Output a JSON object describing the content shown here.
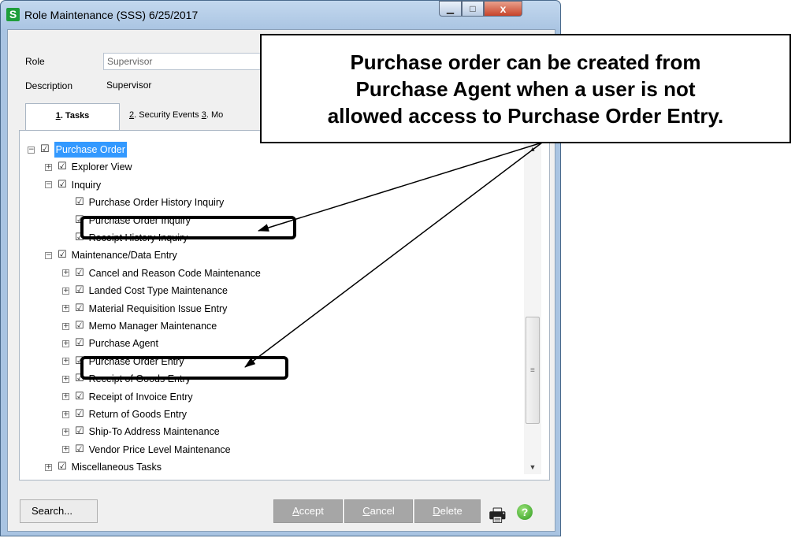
{
  "window": {
    "app_icon_letter": "S",
    "title": "Role Maintenance (SSS) 6/25/2017",
    "min_label": "▁",
    "max_label": "□",
    "close_label": "x"
  },
  "form": {
    "role_label": "Role",
    "role_value": "Supervisor",
    "description_label": "Description",
    "description_value": "Supervisor"
  },
  "tabs": [
    {
      "key": "1",
      "label": ". Tasks"
    },
    {
      "key": "2",
      "label": ". Security Events "
    },
    {
      "key": "3",
      "label": ". Mo"
    }
  ],
  "tree": [
    {
      "label": "Purchase Order",
      "level": 0,
      "expander": "−",
      "selected": true
    },
    {
      "label": "Explorer View",
      "level": 1,
      "expander": "+"
    },
    {
      "label": "Inquiry",
      "level": 1,
      "expander": "−"
    },
    {
      "label": "Purchase Order History Inquiry",
      "level": 2,
      "expander": ""
    },
    {
      "label": "Purchase Order Inquiry",
      "level": 2,
      "expander": ""
    },
    {
      "label": "Receipt History Inquiry",
      "level": 2,
      "expander": ""
    },
    {
      "label": "Maintenance/Data Entry",
      "level": 1,
      "expander": "−"
    },
    {
      "label": "Cancel and Reason Code Maintenance",
      "level": 2,
      "expander": "+"
    },
    {
      "label": "Landed Cost Type Maintenance",
      "level": 2,
      "expander": "+"
    },
    {
      "label": "Material Requisition Issue Entry",
      "level": 2,
      "expander": "+"
    },
    {
      "label": "Memo Manager Maintenance",
      "level": 2,
      "expander": "+"
    },
    {
      "label": "Purchase Agent",
      "level": 2,
      "expander": "+"
    },
    {
      "label": "Purchase Order Entry",
      "level": 2,
      "expander": "+"
    },
    {
      "label": "Receipt of Goods Entry",
      "level": 2,
      "expander": "+"
    },
    {
      "label": "Receipt of Invoice Entry",
      "level": 2,
      "expander": "+"
    },
    {
      "label": "Return of Goods Entry",
      "level": 2,
      "expander": "+"
    },
    {
      "label": "Ship-To Address Maintenance",
      "level": 2,
      "expander": "+"
    },
    {
      "label": "Vendor Price Level Maintenance",
      "level": 2,
      "expander": "+"
    },
    {
      "label": "Miscellaneous Tasks",
      "level": 1,
      "expander": "+"
    }
  ],
  "checkbox_glyph": "☑",
  "buttons": {
    "search": "Search...",
    "accept_key": "A",
    "accept_rest": "ccept",
    "cancel_key": "C",
    "cancel_rest": "ancel",
    "delete_key": "D",
    "delete_rest": "elete",
    "help": "?"
  },
  "icons": {
    "print": "printer-icon",
    "help": "help-icon"
  },
  "callout": {
    "line1": "Purchase order can be created from",
    "line2": "Purchase Agent when a user is not",
    "line3": "allowed access to Purchase Order Entry."
  },
  "colors": {
    "selection": "#3399ff",
    "close": "#c8442a",
    "app_icon": "#1e9e3a"
  }
}
